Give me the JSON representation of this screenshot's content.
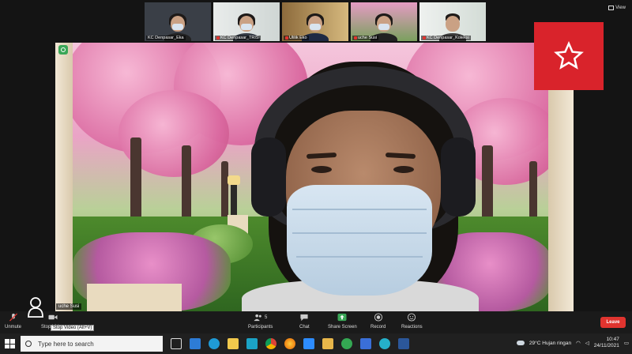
{
  "thumbnails": [
    {
      "name": "KC Denpasar_Eka",
      "bg": "#3a3f47",
      "muted": false
    },
    {
      "name": "KC Denpasar_TRIS",
      "bg": "#d9ddde",
      "muted": true
    },
    {
      "name": "Ulilik Eko",
      "bg": "#c7a86f",
      "muted": true
    },
    {
      "name": "uche Susi",
      "bg": "#b24f7a",
      "muted": true
    },
    {
      "name": "KC Denpasar_Koleksi",
      "bg": "#e2e8e3",
      "muted": true
    }
  ],
  "view_label": "View",
  "presenter_name": "uche Susi",
  "toolbar": {
    "unmute": "Unmute",
    "stop_video": "Stop Video",
    "stop_video_tooltip": "Stop Video (Alt+V)",
    "participants": "Participants",
    "participant_count": "5",
    "chat": "Chat",
    "share_screen": "Share Screen",
    "record": "Record",
    "reactions": "Reactions",
    "leave": "Leave"
  },
  "taskbar": {
    "search_placeholder": "Type here to search",
    "weather": "29°C  Hujan ringan",
    "time": "10:47",
    "date": "24/11/2021"
  },
  "colors": {
    "leave": "#e0342f",
    "share": "#3aa757",
    "star_badge": "#d9232b"
  }
}
